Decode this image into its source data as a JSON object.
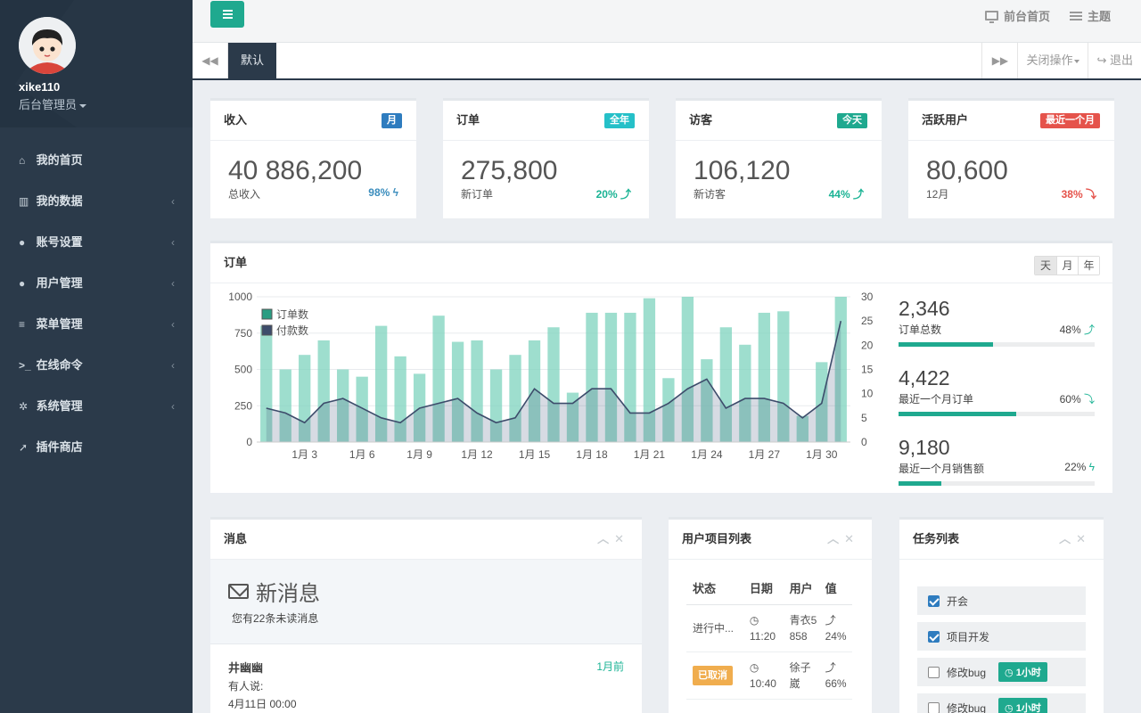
{
  "user": {
    "name": "xike110",
    "role": "后台管理员"
  },
  "sidebar": {
    "items": [
      {
        "label": "我的首页",
        "icon": "home-icon",
        "glyph": "⌂",
        "chevron": false
      },
      {
        "label": "我的数据",
        "icon": "bar-chart-icon",
        "glyph": "▥",
        "chevron": true
      },
      {
        "label": "账号设置",
        "icon": "user-icon",
        "glyph": "●",
        "chevron": true
      },
      {
        "label": "用户管理",
        "icon": "users-icon",
        "glyph": "●",
        "chevron": true
      },
      {
        "label": "菜单管理",
        "icon": "list-icon",
        "glyph": "≡",
        "chevron": true
      },
      {
        "label": "在线命令",
        "icon": "terminal-icon",
        "glyph": ">_",
        "chevron": true
      },
      {
        "label": "系统管理",
        "icon": "gear-icon",
        "glyph": "✲",
        "chevron": true
      },
      {
        "label": "插件商店",
        "icon": "send-icon",
        "glyph": "➚",
        "chevron": false
      }
    ],
    "chevron_glyph": "‹"
  },
  "topbar": {
    "home_label": "前台首页",
    "theme_label": "主题"
  },
  "tabs": {
    "active": "默认",
    "close_ops": "关闭操作",
    "logout": "退出",
    "prev_glyph": "◀◀",
    "next_glyph": "▶▶"
  },
  "stats": [
    {
      "title": "收入",
      "label": "月",
      "label_color": "#2e7cbf",
      "value": "40 886,200",
      "sub": "总收入",
      "pct": "98%",
      "arrow": "ϟ",
      "pct_class": "blue"
    },
    {
      "title": "订单",
      "label": "全年",
      "label_color": "#25c0c8",
      "value": "275,800",
      "sub": "新订单",
      "pct": "20%",
      "arrow": "⤴",
      "pct_class": "green"
    },
    {
      "title": "访客",
      "label": "今天",
      "label_color": "#1fa98f",
      "value": "106,120",
      "sub": "新访客",
      "pct": "44%",
      "arrow": "⤴",
      "pct_class": "green"
    },
    {
      "title": "活跃用户",
      "label": "最近一个月",
      "label_color": "#e5534b",
      "value": "80,600",
      "sub": "12月",
      "pct": "38%",
      "arrow": "⤵",
      "pct_class": "red"
    }
  ],
  "orders_panel": {
    "title": "订单",
    "ranges": [
      "天",
      "月",
      "年"
    ],
    "kpis": [
      {
        "value": "2,346",
        "label": "订单总数",
        "pct": "48%",
        "arrow": "⤴",
        "fill": 0.48
      },
      {
        "value": "4,422",
        "label": "最近一个月订单",
        "pct": "60%",
        "arrow": "⤵",
        "fill": 0.6
      },
      {
        "value": "9,180",
        "label": "最近一个月销售额",
        "pct": "22%",
        "arrow": "ϟ",
        "fill": 0.22
      }
    ]
  },
  "chart_data": {
    "type": "bar",
    "x": [
      1,
      2,
      3,
      4,
      5,
      6,
      7,
      8,
      9,
      10,
      11,
      12,
      13,
      14,
      15,
      16,
      17,
      18,
      19,
      20,
      21,
      22,
      23,
      24,
      25,
      26,
      27,
      28,
      29,
      30,
      31
    ],
    "xticks": [
      "1月 3",
      "1月 6",
      "1月 9",
      "1月 12",
      "1月 15",
      "1月 18",
      "1月 21",
      "1月 24",
      "1月 27",
      "1月 30"
    ],
    "xtick_days": [
      3,
      6,
      9,
      12,
      15,
      18,
      21,
      24,
      27,
      30
    ],
    "series": [
      {
        "name": "订单数",
        "axis": "left",
        "color": "#7dd3bd",
        "values": [
          800,
          500,
          600,
          700,
          500,
          450,
          800,
          590,
          470,
          870,
          690,
          700,
          500,
          600,
          700,
          790,
          340,
          890,
          890,
          890,
          990,
          440,
          1000,
          570,
          790,
          670,
          890,
          900,
          180,
          550,
          1000
        ]
      },
      {
        "name": "付款数",
        "axis": "right",
        "color": "#3d4c6b",
        "values": [
          7,
          6,
          4,
          8,
          9,
          7,
          5,
          4,
          7,
          8,
          9,
          6,
          4,
          5,
          11,
          8,
          8,
          11,
          11,
          6,
          6,
          8,
          11,
          13,
          7,
          9,
          9,
          8,
          5,
          8,
          25
        ]
      }
    ],
    "yleft": {
      "ticks": [
        0,
        250,
        500,
        750,
        1000
      ],
      "lim": [
        0,
        1000
      ]
    },
    "yright": {
      "ticks": [
        0,
        5,
        10,
        15,
        20,
        25,
        30
      ],
      "lim": [
        0,
        30
      ]
    },
    "legend": "top-left"
  },
  "messages": {
    "title": "消息",
    "hero_title": "新消息",
    "hero_sub": "您有22条未读消息",
    "items": [
      {
        "author": "井幽幽",
        "ago": "1月前",
        "line1": "有人说:",
        "line2": "4月11日 00:00"
      }
    ]
  },
  "user_projects": {
    "title": "用户项目列表",
    "headers": [
      "状态",
      "日期",
      "用户",
      "值"
    ],
    "rows": [
      {
        "status": "进行中...",
        "status_label": false,
        "time": "11:20",
        "user": "青衣5858",
        "value": "24%"
      },
      {
        "status": "已取消",
        "status_label": true,
        "time": "10:40",
        "user": "徐子崴",
        "value": "66%"
      }
    ],
    "clock_glyph": "◷",
    "up_glyph": "⤴"
  },
  "tasks": {
    "title": "任务列表",
    "items": [
      {
        "label": "开会",
        "checked": true,
        "badge": ""
      },
      {
        "label": "项目开发",
        "checked": true,
        "badge": ""
      },
      {
        "label": "修改bug",
        "checked": false,
        "badge": "1小时"
      },
      {
        "label": "修改bug",
        "checked": false,
        "badge": "1小时"
      }
    ]
  },
  "colors": {
    "sidebar_bg": "#2b3a4a",
    "accent": "#1fa98f",
    "blue": "#2e7cbf",
    "red": "#e5534b"
  }
}
